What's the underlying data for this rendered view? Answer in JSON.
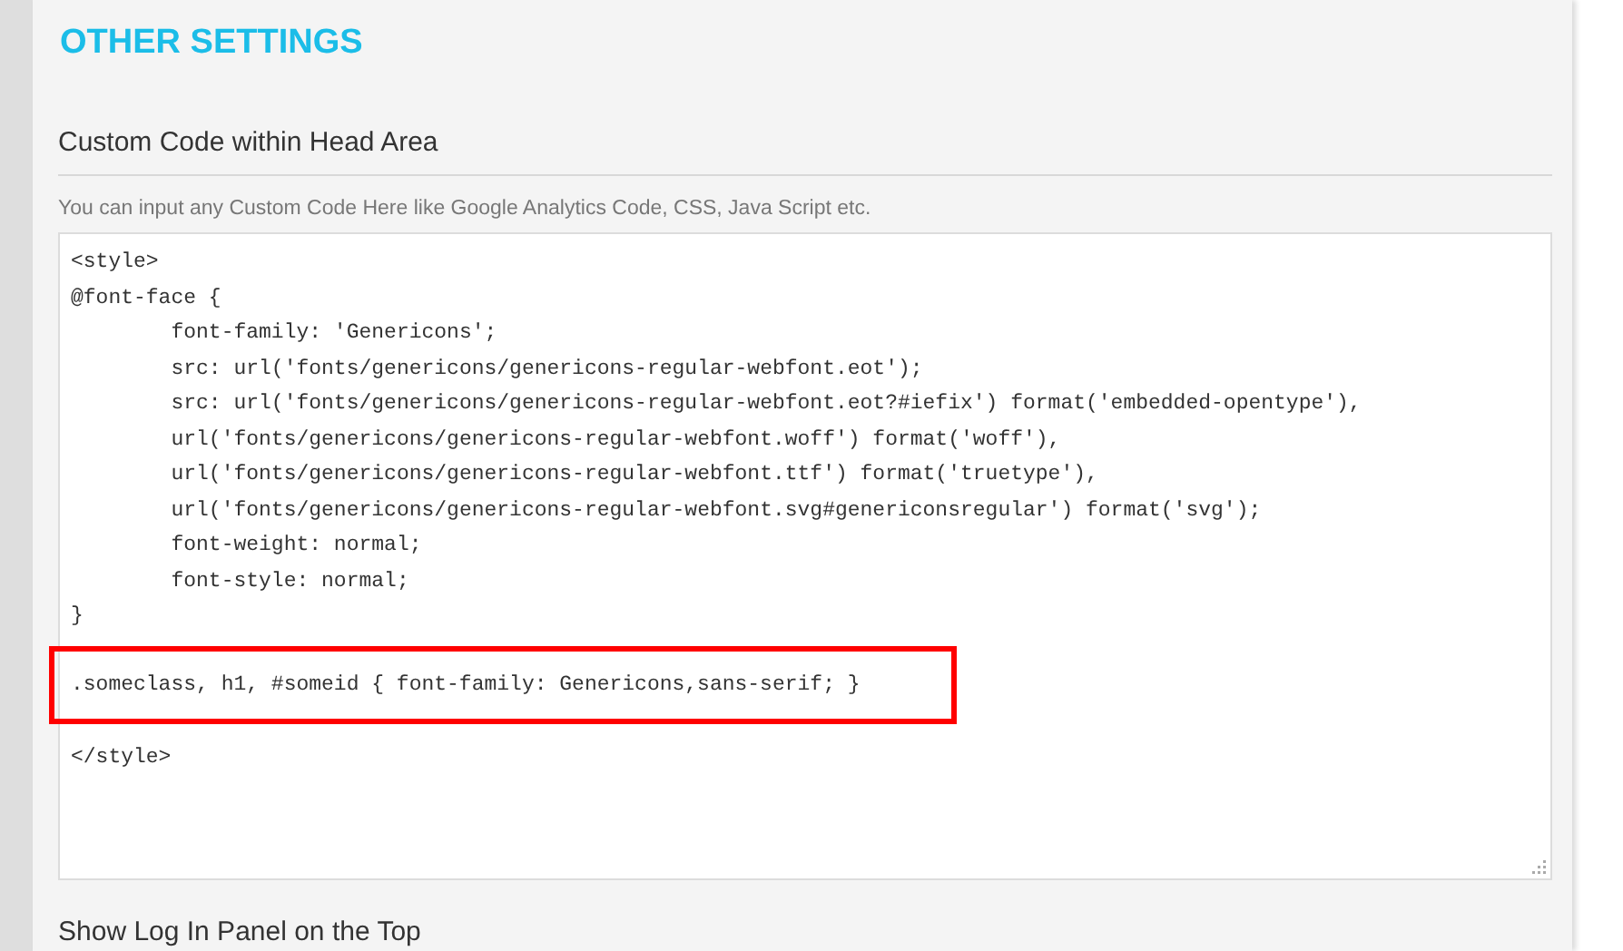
{
  "section_title": "OTHER SETTINGS",
  "setting": {
    "heading": "Custom Code within Head Area",
    "description": "You can input any Custom Code Here like Google Analytics Code, CSS, Java Script etc.",
    "code_lines": [
      {
        "text": "<style>",
        "highlighted": false
      },
      {
        "text": "@font-face {",
        "highlighted": false
      },
      {
        "text": "\tfont-family: 'Genericons';",
        "highlighted": false
      },
      {
        "text": "\tsrc: url('fonts/genericons/genericons-regular-webfont.eot');",
        "highlighted": false
      },
      {
        "text": "\tsrc: url('fonts/genericons/genericons-regular-webfont.eot?#iefix') format('embedded-opentype'),",
        "highlighted": false
      },
      {
        "text": "\turl('fonts/genericons/genericons-regular-webfont.woff') format('woff'),",
        "highlighted": false
      },
      {
        "text": "\turl('fonts/genericons/genericons-regular-webfont.ttf') format('truetype'),",
        "highlighted": false
      },
      {
        "text": "\turl('fonts/genericons/genericons-regular-webfont.svg#genericonsregular') format('svg');",
        "highlighted": false
      },
      {
        "text": "\tfont-weight: normal;",
        "highlighted": false
      },
      {
        "text": "\tfont-style: normal;",
        "highlighted": false
      },
      {
        "text": "}",
        "highlighted": false
      },
      {
        "text": ".someclass, h1, #someid { font-family: Genericons,sans-serif; }",
        "highlighted": true
      },
      {
        "text": "</style>",
        "highlighted": false
      }
    ]
  },
  "next_setting": {
    "heading": "Show Log In Panel on the Top"
  }
}
